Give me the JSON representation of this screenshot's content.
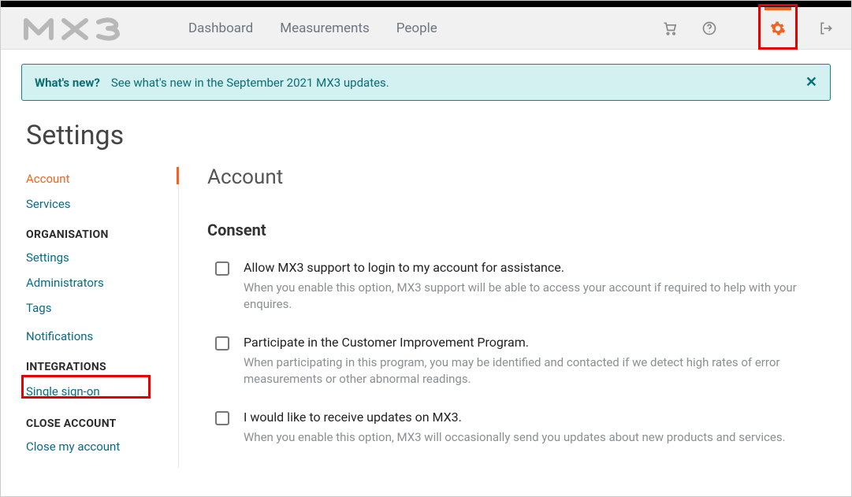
{
  "nav": {
    "dashboard": "Dashboard",
    "measurements": "Measurements",
    "people": "People"
  },
  "banner": {
    "label": "What's new?",
    "text": "See what's new in the September 2021 MX3 updates."
  },
  "page_title": "Settings",
  "sidebar": {
    "account": "Account",
    "services": "Services",
    "section_org": "ORGANISATION",
    "settings": "Settings",
    "administrators": "Administrators",
    "tags": "Tags",
    "notifications": "Notifications",
    "section_int": "INTEGRATIONS",
    "sso": "Single sign-on",
    "section_close": "CLOSE ACCOUNT",
    "close_account": "Close my account"
  },
  "main": {
    "heading": "Account",
    "consent_heading": "Consent",
    "items": [
      {
        "title": "Allow MX3 support to login to my account for assistance.",
        "desc": "When you enable this option, MX3 support will be able to access your account if required to help with your enquires."
      },
      {
        "title": "Participate in the Customer Improvement Program.",
        "desc": "When participating in this program, you may be identified and contacted if we detect high rates of error measurements or other abnormal readings."
      },
      {
        "title": "I would like to receive updates on MX3.",
        "desc": "When you enable this option, MX3 will occasionally send you updates about new products and services."
      }
    ]
  }
}
